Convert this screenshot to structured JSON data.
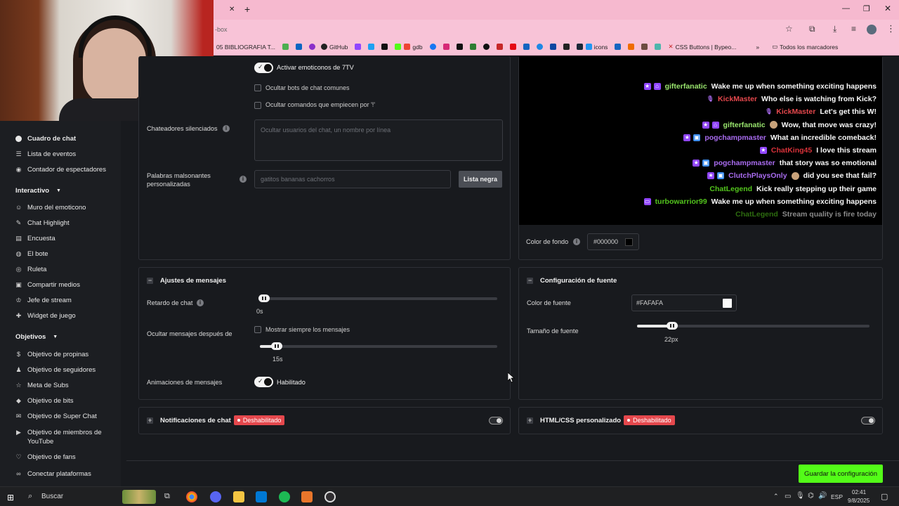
{
  "browser": {
    "url_fragment": "-box",
    "bookmarks": [
      "05 BIBLIOGRAFIA T...",
      "GitHub",
      "gdb",
      "icons",
      "CSS Buttons | Bypeo...",
      "Todos los marcadores"
    ]
  },
  "sidebar": {
    "items_top": [
      {
        "label": "Cuadro de chat",
        "icon": "circle-icon",
        "active": true
      },
      {
        "label": "Lista de eventos",
        "icon": "list-icon"
      },
      {
        "label": "Contador de espectadores",
        "icon": "eye-icon"
      }
    ],
    "section_interactivo": "Interactivo",
    "items_interactivo": [
      {
        "label": "Muro del emoticono",
        "icon": "smiley-icon"
      },
      {
        "label": "Chat Highlight",
        "icon": "pencil-icon"
      },
      {
        "label": "Encuesta",
        "icon": "poll-icon"
      },
      {
        "label": "El bote",
        "icon": "pot-icon"
      },
      {
        "label": "Ruleta",
        "icon": "wheel-icon"
      },
      {
        "label": "Compartir medios",
        "icon": "media-icon"
      },
      {
        "label": "Jefe de stream",
        "icon": "crown-icon"
      },
      {
        "label": "Widget de juego",
        "icon": "gamepad-icon"
      }
    ],
    "section_objetivos": "Objetivos",
    "items_objetivos": [
      {
        "label": "Objetivo de propinas",
        "icon": "tip-icon"
      },
      {
        "label": "Objetivo de seguidores",
        "icon": "users-icon"
      },
      {
        "label": "Meta de Subs",
        "icon": "star-icon"
      },
      {
        "label": "Objetivo de bits",
        "icon": "bits-icon"
      },
      {
        "label": "Objetivo de Super Chat",
        "icon": "superchat-icon"
      },
      {
        "label": "Objetivo de miembros de YouTube",
        "icon": "youtube-icon"
      },
      {
        "label": "Objetivo de fans",
        "icon": "heart-icon"
      },
      {
        "label": "Conectar plataformas",
        "icon": "link-icon"
      }
    ]
  },
  "chat_settings": {
    "emotes_7tv_label": "Activar emoticonos de 7TV",
    "hide_bots_label": "Ocultar bots de chat comunes",
    "hide_commands_label": "Ocultar comandos que empiecen por '!'",
    "muted_label": "Chateadores silenciados",
    "muted_placeholder": "Ocultar usuarios del chat, un nombre por línea",
    "badwords_label": "Palabras malsonantes personalizadas",
    "badwords_placeholder": "gatitos bananas cachorros",
    "blacklist_button": "Lista negra"
  },
  "preview": {
    "messages": [
      {
        "user": "gifterfanatic",
        "user_color": "#9ae66e",
        "text": "Wake me up when something exciting happens",
        "badges": [
          "star",
          "gift"
        ]
      },
      {
        "user": "KickMaster",
        "user_color": "#e5484d",
        "text": "Who else is watching from Kick?",
        "badges": [
          "mic"
        ]
      },
      {
        "user": "KickMaster",
        "user_color": "#e5484d",
        "text": "Let's get this W!",
        "badges": [
          "mic"
        ]
      },
      {
        "user": "gifterfanatic",
        "user_color": "#9ae66e",
        "text": "Wow, that move was crazy!",
        "badges": [
          "star",
          "gift"
        ],
        "emote": true
      },
      {
        "user": "pogchampmaster",
        "user_color": "#a96cf0",
        "text": "What an incredible comeback!",
        "badges": [
          "star",
          "sub"
        ]
      },
      {
        "user": "ChatKing45",
        "user_color": "#d8323a",
        "text": "I love this stream",
        "badges": [
          "star"
        ]
      },
      {
        "user": "pogchampmaster",
        "user_color": "#a96cf0",
        "text": "that story was so emotional",
        "badges": [
          "star",
          "sub"
        ]
      },
      {
        "user": "ClutchPlaysOnly",
        "user_color": "#a96cf0",
        "text": "did you see that fail?",
        "badges": [
          "star",
          "sub"
        ],
        "emote": true
      },
      {
        "user": "ChatLegend",
        "user_color": "#53c51d",
        "text": "Kick really stepping up their game",
        "badges": []
      },
      {
        "user": "turbowarrior99",
        "user_color": "#53c51d",
        "text": "Wake me up when something exciting happens",
        "badges": [
          "tv"
        ]
      },
      {
        "user": "ChatLegend",
        "user_color": "#53c51d",
        "text": "Stream quality is fire today",
        "badges": [],
        "faded": true
      }
    ],
    "bg_color_label": "Color de fondo",
    "bg_color_value": "#000000"
  },
  "message_settings": {
    "title": "Ajustes de mensajes",
    "delay_label": "Retardo de chat",
    "delay_value": "0s",
    "delay_fraction": 0.0,
    "hide_after_label": "Ocultar mensajes después de",
    "always_show_label": "Mostrar siempre los mensajes",
    "hide_after_value": "15s",
    "hide_after_fraction": 0.07,
    "animations_label": "Animaciones de mensajes",
    "animations_value": "Habilitado"
  },
  "font_settings": {
    "title": "Configuración de fuente",
    "color_label": "Color de fuente",
    "color_value": "#FAFAFA",
    "size_label": "Tamaño de fuente",
    "size_value": "22px",
    "size_fraction": 0.15
  },
  "notifications": {
    "title": "Notificaciones de chat",
    "status": "Deshabilitado"
  },
  "custom_css": {
    "title": "HTML/CSS personalizado",
    "status": "Deshabilitado"
  },
  "save_button": "Guardar la configuración",
  "taskbar": {
    "search_label": "Buscar",
    "lang": "ESP",
    "time": "02:41",
    "date": "9/8/2025"
  }
}
